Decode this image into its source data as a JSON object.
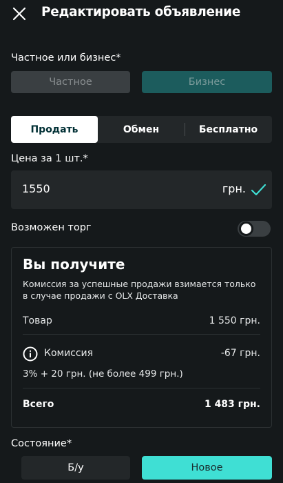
{
  "header": {
    "title": "Редактировать объявление",
    "close_icon": "close-icon"
  },
  "seller_type": {
    "label": "Частное или бизнес*",
    "options": [
      "Частное",
      "Бизнес"
    ],
    "selected": "Бизнес"
  },
  "deal_tabs": {
    "items": [
      "Продать",
      "Обмен",
      "Бесплатно"
    ],
    "active": "Продать"
  },
  "price": {
    "label": "Цена за 1 шт.*",
    "value": "1550",
    "currency": "грн.",
    "status_icon": "check-icon"
  },
  "negotiable": {
    "label": "Возможен торг",
    "enabled": false
  },
  "summary": {
    "title": "Вы получите",
    "note": "Комиссия за успешные продажи взимается только в случае продажи с OLX Доставка",
    "item_label": "Товар",
    "item_value": "1 550 грн.",
    "commission_label": "Комиссия",
    "commission_value": "-67 грн.",
    "commission_note": "3% + 20 грн. (не более 499 грн.)",
    "total_label": "Всего",
    "total_value": "1 483 грн."
  },
  "condition": {
    "label": "Состояние*",
    "options": [
      "Б/у",
      "Новое"
    ],
    "selected": "Новое"
  },
  "colors": {
    "background": "#15191b",
    "accent": "#3fdfd4",
    "business_selected": "#1c5c5d",
    "field": "#232729"
  }
}
